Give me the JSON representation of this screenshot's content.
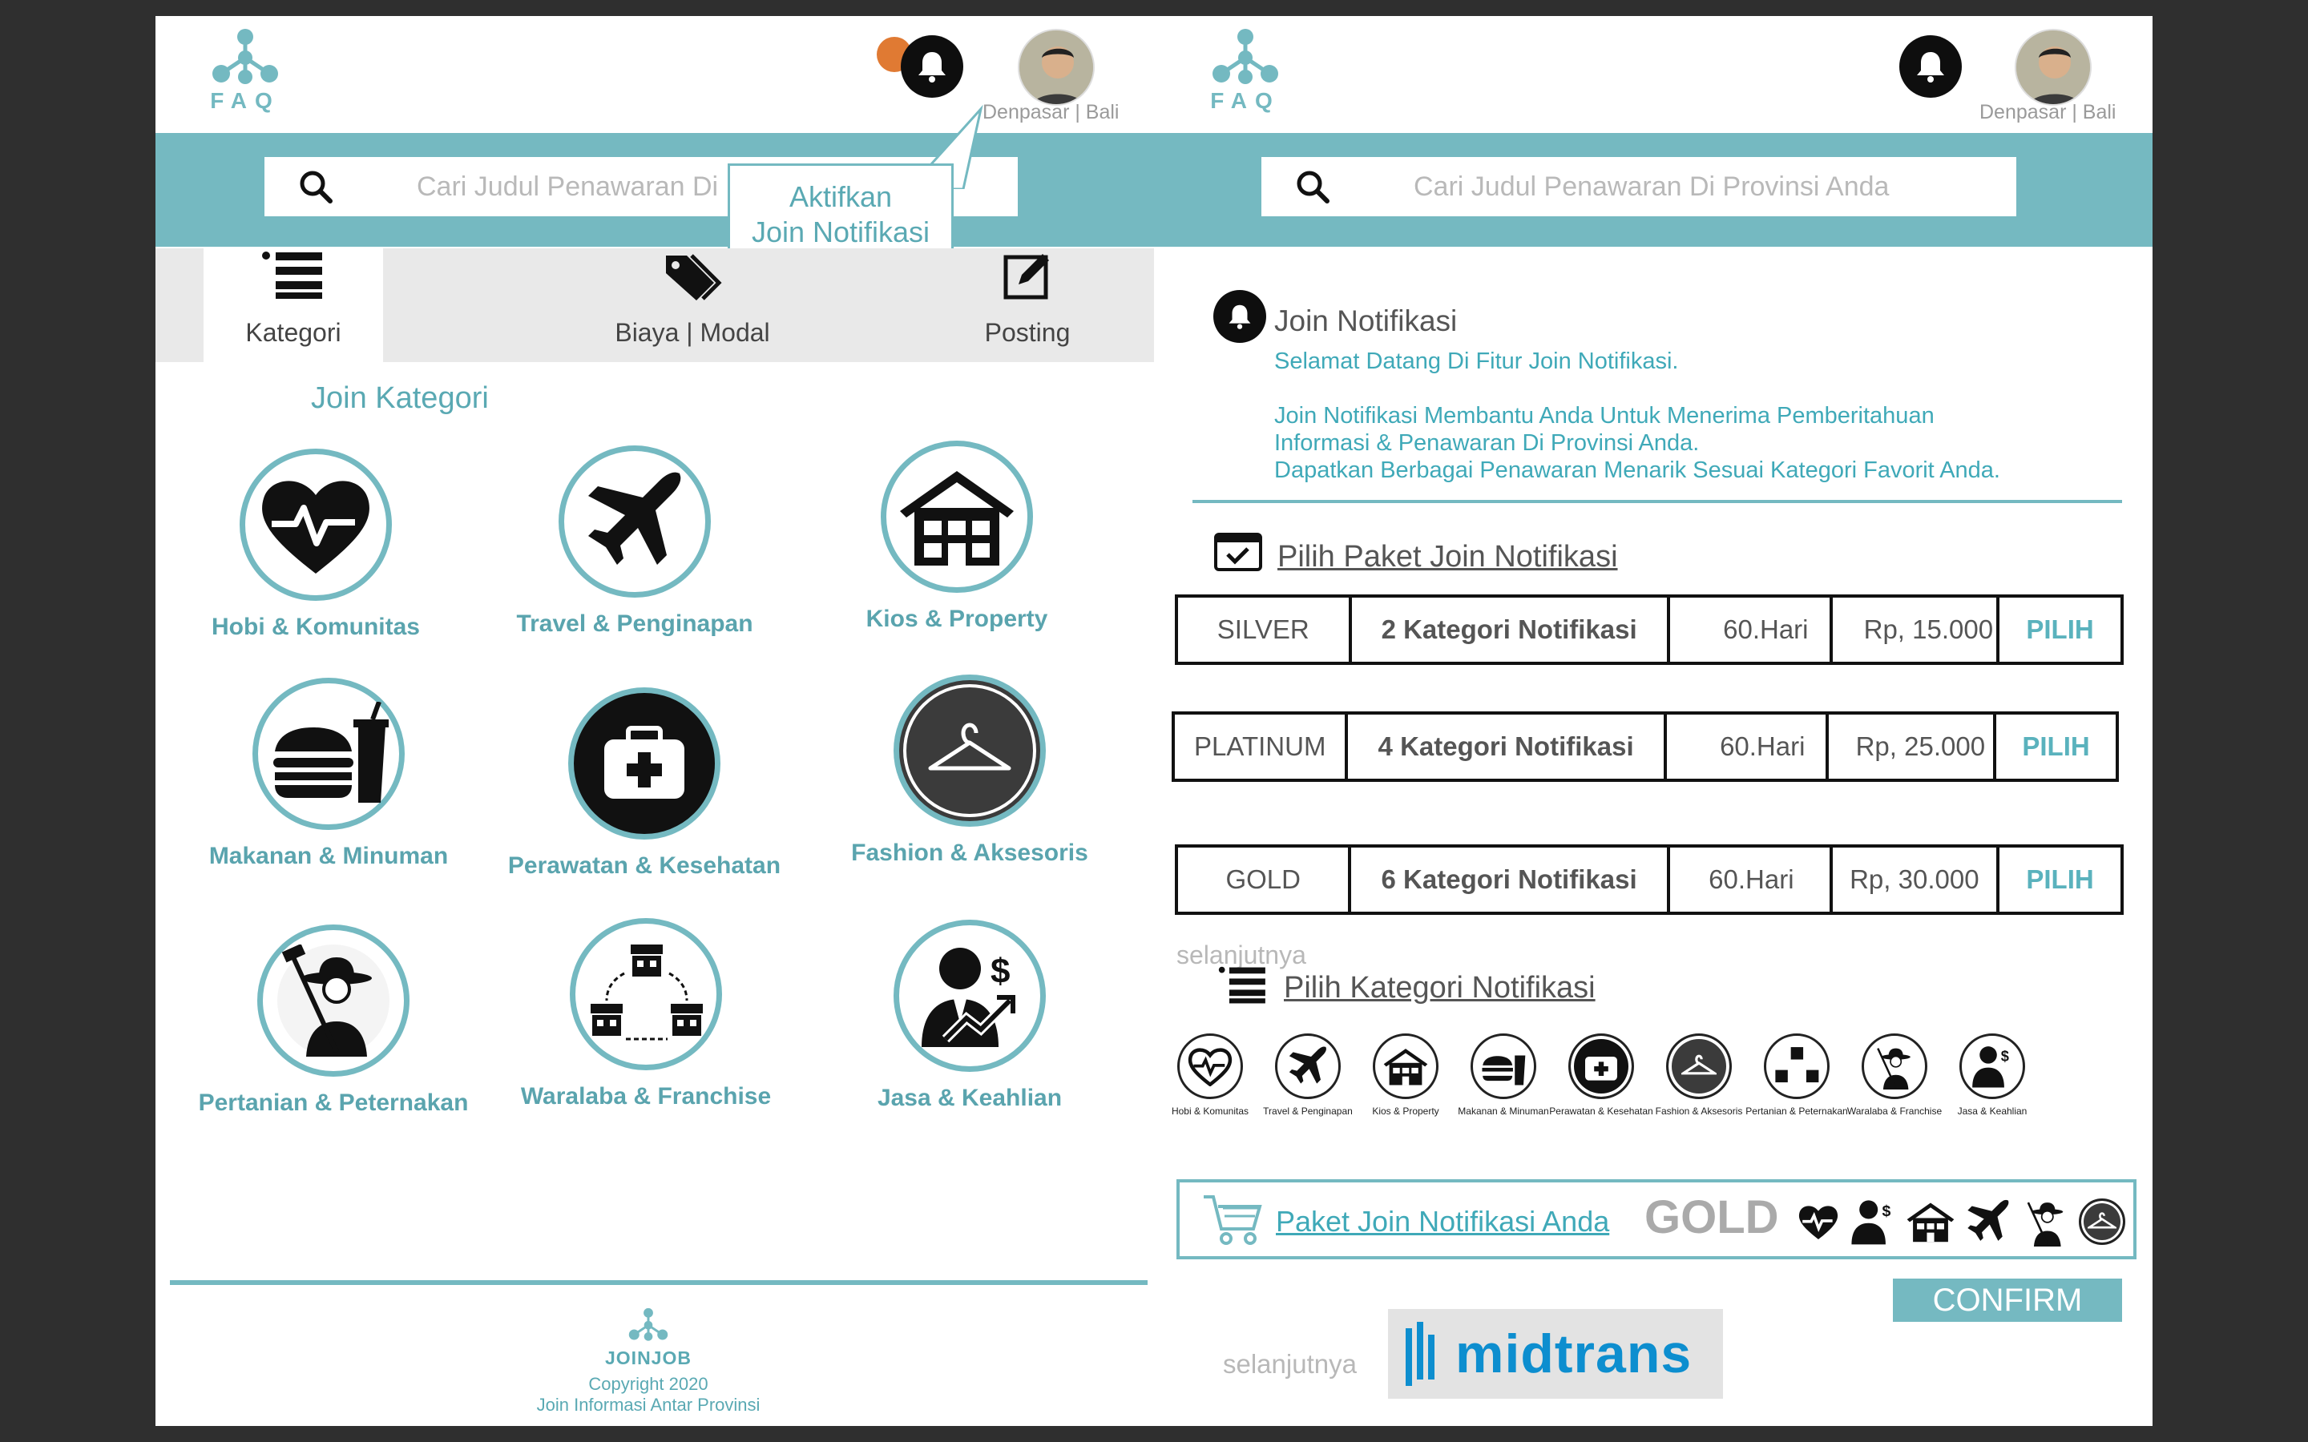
{
  "left": {
    "logo": "FAQ",
    "location": "Denpasar | Bali",
    "search_placeholder": "Cari Judul Penawaran Di Provinsi Anda",
    "tooltip": [
      "Aktifkan",
      "Join Notifikasi"
    ],
    "tabs": [
      {
        "label": "Kategori",
        "icon": "list-icon"
      },
      {
        "label": "Biaya | Modal",
        "icon": "tags-icon"
      },
      {
        "label": "Posting",
        "icon": "edit-icon"
      }
    ],
    "section_title": "Join Kategori",
    "categories": [
      {
        "label": "Hobi & Komunitas",
        "icon": "heart-pulse-icon"
      },
      {
        "label": "Travel & Penginapan",
        "icon": "airplane-icon"
      },
      {
        "label": "Kios & Property",
        "icon": "building-icon"
      },
      {
        "label": "Makanan & Minuman",
        "icon": "burger-drink-icon"
      },
      {
        "label": "Perawatan & Kesehatan",
        "icon": "medical-kit-icon"
      },
      {
        "label": "Fashion & Aksesoris",
        "icon": "hanger-icon"
      },
      {
        "label": "Pertanian & Peternakan",
        "icon": "farmer-icon"
      },
      {
        "label": "Waralaba & Franchise",
        "icon": "franchise-stores-icon"
      },
      {
        "label": "Jasa & Keahlian",
        "icon": "business-person-icon"
      }
    ],
    "footer": {
      "brand": "JOINJOB",
      "copyright": "Copyright 2020",
      "tagline": "Join Informasi Antar Provinsi"
    }
  },
  "right": {
    "logo": "FAQ",
    "location": "Denpasar | Bali",
    "search_placeholder": "Cari Judul Penawaran Di Provinsi Anda",
    "notif_title": "Join Notifikasi",
    "notif_lines": [
      "Selamat Datang Di Fitur Join Notifikasi.",
      "Join Notifikasi Membantu Anda Untuk Menerima Pemberitahuan",
      "Informasi & Penawaran Di Provinsi Anda.",
      "Dapatkan Berbagai Penawaran Menarik Sesuai Kategori Favorit Anda."
    ],
    "paket_title": "Pilih Paket Join Notifikasi",
    "packages": [
      {
        "name": "SILVER",
        "kategori": "2 Kategori Notifikasi",
        "durasi": "60.Hari",
        "harga": "Rp, 15.000",
        "action": "PILIH"
      },
      {
        "name": "PLATINUM",
        "kategori": "4 Kategori Notifikasi",
        "durasi": "60.Hari",
        "harga": "Rp, 25.000",
        "action": "PILIH"
      },
      {
        "name": "GOLD",
        "kategori": "6 Kategori Notifikasi",
        "durasi": "60.Hari",
        "harga": "Rp, 30.000",
        "action": "PILIH"
      }
    ],
    "next_1": "selanjutnya",
    "kategori_title": "Pilih Kategori Notifikasi",
    "mini_categories": [
      "Hobi & Komunitas",
      "Travel & Penginapan",
      "Kios & Property",
      "Makanan & Minuman",
      "Perawatan & Kesehatan",
      "Fashion & Aksesoris",
      "Pertanian & Peternakan",
      "Waralaba & Franchise",
      "Jasa & Keahlian"
    ],
    "cart_label": "Paket Join Notifikasi Anda",
    "selected_package": "GOLD",
    "confirm": "CONFIRM",
    "next_2": "selanjutnya",
    "payment_brand": "midtrans"
  },
  "colors": {
    "accent": "#75b9c1",
    "dark": "#111111",
    "notif_dot": "#e07a33"
  }
}
